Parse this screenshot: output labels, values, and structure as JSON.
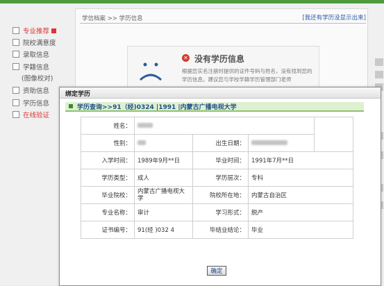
{
  "background": {
    "breadcrumb": "学信档案 >> 学历信息",
    "report_link": "[我还有学历没显示出来]",
    "sidebar": [
      {
        "label": "专业推荐",
        "highlight": true
      },
      {
        "label": "院校满意度",
        "highlight": false
      },
      {
        "label": "录取信息",
        "highlight": false
      },
      {
        "label": "学籍信息",
        "highlight": false
      },
      {
        "label": "(图像校对)",
        "highlight": false
      },
      {
        "label": "资助信息",
        "highlight": false
      },
      {
        "label": "学历信息",
        "highlight": false
      },
      {
        "label": "在线验证",
        "highlight": true
      }
    ],
    "no_result_title": "没有学历信息",
    "no_result_desc": "根据您实名注册时提供的证件号码与姓名，没有找到您的学历信息。建议您与学校学籍学历管理部门老师"
  },
  "modal": {
    "title": "绑定学历",
    "query_label": "学历查询>>91（经)0324 |1991 |内蒙古广播电视大学",
    "ok_label": "确定",
    "rows": [
      {
        "l1": "姓名：",
        "v1": "",
        "l2": "",
        "v2": ""
      },
      {
        "l1": "性别：",
        "v1": "",
        "l2": "出生日期：",
        "v2": ""
      },
      {
        "l1": "入学时间：",
        "v1": "1989年9月**日",
        "l2": "毕业时间：",
        "v2": "1991年7月**日"
      },
      {
        "l1": "学历类型：",
        "v1": "成人",
        "l2": "学历层次：",
        "v2": "专科"
      },
      {
        "l1": "毕业院校：",
        "v1": "内蒙古广播电视大学",
        "l2": "院校所在地：",
        "v2": "内蒙古自治区"
      },
      {
        "l1": "专业名称：",
        "v1": "审计",
        "l2": "学习形式：",
        "v2": "脱产"
      },
      {
        "l1": "证书编号：",
        "v1": "91(经 )032 4",
        "l2": "毕结业结论：",
        "v2": "毕业"
      }
    ]
  },
  "colors": {
    "accent_green": "#4e9a3e",
    "link_blue": "#1f4f8a",
    "error_red": "#d23b2b"
  }
}
